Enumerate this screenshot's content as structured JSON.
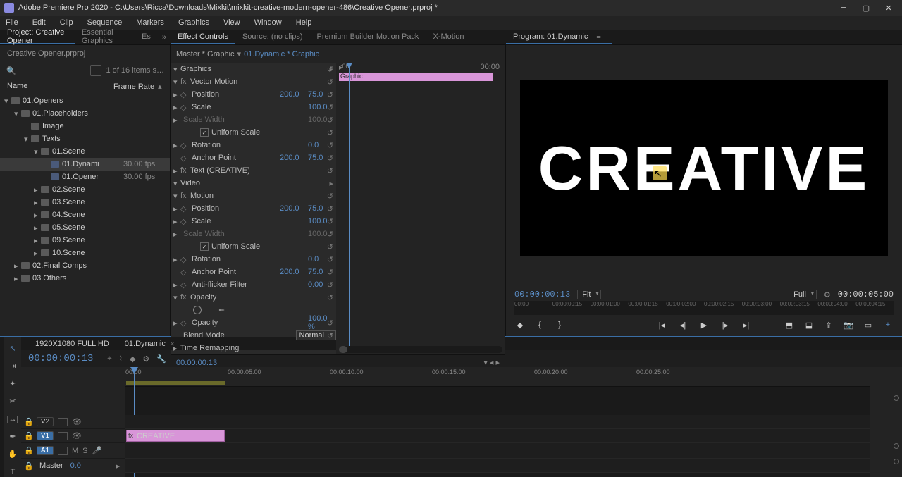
{
  "window": {
    "title": "Adobe Premiere Pro 2020 - C:\\Users\\Ricca\\Downloads\\Mixkit\\mixkit-creative-modern-opener-486\\Creative Opener.prproj *"
  },
  "menu": {
    "items": [
      "File",
      "Edit",
      "Clip",
      "Sequence",
      "Markers",
      "Graphics",
      "View",
      "Window",
      "Help"
    ]
  },
  "top_tabs_left": [
    {
      "label": "Project: Creative Opener",
      "active": true
    },
    {
      "label": "Essential Graphics",
      "active": false
    },
    {
      "label": "Es",
      "active": false
    }
  ],
  "top_tabs_mid": [
    {
      "label": "Effect Controls",
      "active": true
    },
    {
      "label": "Source: (no clips)",
      "active": false
    },
    {
      "label": "Premium Builder Motion Pack",
      "active": false
    },
    {
      "label": "X-Motion",
      "active": false
    }
  ],
  "program_header": "Program: 01.Dynamic",
  "project": {
    "subtitle": "Creative Opener.prproj",
    "items_info": "1 of 16 items s…",
    "col_name": "Name",
    "col_fr": "Frame Rate",
    "tree": [
      {
        "indent": 0,
        "toggle": "▾",
        "icon": "folder",
        "label": "01.Openers",
        "fr": ""
      },
      {
        "indent": 1,
        "toggle": "▾",
        "icon": "folder",
        "label": "01.Placeholders",
        "fr": ""
      },
      {
        "indent": 2,
        "toggle": "",
        "icon": "folder",
        "label": "Image",
        "fr": ""
      },
      {
        "indent": 2,
        "toggle": "▾",
        "icon": "folder",
        "label": "Texts",
        "fr": ""
      },
      {
        "indent": 3,
        "toggle": "▾",
        "icon": "folder",
        "label": "01.Scene",
        "fr": ""
      },
      {
        "indent": 4,
        "toggle": "",
        "icon": "seq",
        "label": "01.Dynami",
        "fr": "30.00 fps",
        "selected": true
      },
      {
        "indent": 4,
        "toggle": "",
        "icon": "seq",
        "label": "01.Opener",
        "fr": "30.00 fps"
      },
      {
        "indent": 3,
        "toggle": "▸",
        "icon": "folder",
        "label": "02.Scene",
        "fr": ""
      },
      {
        "indent": 3,
        "toggle": "▸",
        "icon": "folder",
        "label": "03.Scene",
        "fr": ""
      },
      {
        "indent": 3,
        "toggle": "▸",
        "icon": "folder",
        "label": "04.Scene",
        "fr": ""
      },
      {
        "indent": 3,
        "toggle": "▸",
        "icon": "folder",
        "label": "05.Scene",
        "fr": ""
      },
      {
        "indent": 3,
        "toggle": "▸",
        "icon": "folder",
        "label": "09.Scene",
        "fr": ""
      },
      {
        "indent": 3,
        "toggle": "▸",
        "icon": "folder",
        "label": "10.Scene",
        "fr": ""
      },
      {
        "indent": 1,
        "toggle": "▸",
        "icon": "folder",
        "label": "02.Final Comps",
        "fr": ""
      },
      {
        "indent": 1,
        "toggle": "▸",
        "icon": "folder",
        "label": "03.Others",
        "fr": ""
      }
    ]
  },
  "effect_controls": {
    "master": "Master * Graphic",
    "arrow": "▾",
    "instance": "01.Dynamic * Graphic",
    "clip_label": "Graphic",
    "time_right": "00:00",
    "ruler_left": ":00:",
    "rows": [
      {
        "type": "group",
        "toggle": "▾",
        "name": "Graphics",
        "reset": true,
        "play": true
      },
      {
        "type": "fx",
        "toggle": "▾",
        "fx": true,
        "name": "Vector Motion",
        "reset": true
      },
      {
        "type": "prop",
        "toggle": "▸",
        "key": true,
        "name": "Position",
        "v1": "200.0",
        "v2": "75.0",
        "reset": true
      },
      {
        "type": "prop",
        "toggle": "▸",
        "key": true,
        "name": "Scale",
        "v1": "100.0",
        "reset": true
      },
      {
        "type": "prop",
        "toggle": "▸",
        "dim": true,
        "name": "Scale Width",
        "v1": "100.0",
        "reset": true
      },
      {
        "type": "check",
        "checked": true,
        "name": "Uniform Scale",
        "reset": true
      },
      {
        "type": "prop",
        "toggle": "▸",
        "key": true,
        "name": "Rotation",
        "v1": "0.0",
        "reset": true
      },
      {
        "type": "prop",
        "key": true,
        "name": "Anchor Point",
        "v1": "200.0",
        "v2": "75.0",
        "reset": true
      },
      {
        "type": "fx",
        "toggle": "▸",
        "fx": true,
        "name": "Text (CREATIVE)",
        "reset": true
      },
      {
        "type": "group",
        "toggle": "▾",
        "name": "Video",
        "play": true
      },
      {
        "type": "fx",
        "toggle": "▾",
        "fx": true,
        "name": "Motion",
        "reset": true
      },
      {
        "type": "prop",
        "toggle": "▸",
        "key": true,
        "name": "Position",
        "v1": "200.0",
        "v2": "75.0",
        "reset": true
      },
      {
        "type": "prop",
        "toggle": "▸",
        "key": true,
        "name": "Scale",
        "v1": "100.0",
        "reset": true
      },
      {
        "type": "prop",
        "toggle": "▸",
        "dim": true,
        "name": "Scale Width",
        "v1": "100.0",
        "reset": true
      },
      {
        "type": "check",
        "checked": true,
        "name": "Uniform Scale",
        "reset": true
      },
      {
        "type": "prop",
        "toggle": "▸",
        "key": true,
        "name": "Rotation",
        "v1": "0.0",
        "reset": true
      },
      {
        "type": "prop",
        "key": true,
        "name": "Anchor Point",
        "v1": "200.0",
        "v2": "75.0",
        "reset": true
      },
      {
        "type": "prop",
        "toggle": "▸",
        "key": true,
        "name": "Anti-flicker Filter",
        "v1": "0.00",
        "reset": true
      },
      {
        "type": "fx",
        "toggle": "▾",
        "fx": true,
        "name": "Opacity",
        "reset": true
      },
      {
        "type": "masks"
      },
      {
        "type": "prop",
        "toggle": "▸",
        "key": true,
        "name": "Opacity",
        "v1": "100.0 %",
        "reset": true
      },
      {
        "type": "select",
        "name": "Blend Mode",
        "value": "Normal",
        "reset": true
      },
      {
        "type": "fx",
        "toggle": "▸",
        "name": "Time Remapping"
      }
    ],
    "bottom_tc": "00:00:00:13"
  },
  "program": {
    "text": "CREATIVE",
    "tc": "00:00:00:13",
    "fit": "Fit",
    "full": "Full",
    "duration": "00:00:05:00",
    "ruler": [
      "00:00",
      "00:00:00:15",
      "00:00:01:00",
      "00:00:01:15",
      "00:00:02:00",
      "00:00:02:15",
      "00:00:03:00",
      "00:00:03:15",
      "00:00:04:00",
      "00:00:04:15"
    ]
  },
  "timeline": {
    "tabs": [
      {
        "label": "1920X1080 FULL HD",
        "active": false
      },
      {
        "label": "01.Dynamic",
        "active": true
      }
    ],
    "tc": "00:00:00:13",
    "ruler": [
      "00:00",
      "00:00:05:00",
      "00:00:10:00",
      "00:00:15:00",
      "00:00:20:00",
      "00:00:25:00"
    ],
    "tracks_v": [
      {
        "label": "V2"
      },
      {
        "label": "V1",
        "selected": true
      }
    ],
    "tracks_a": [
      {
        "label": "A1",
        "selected": true
      }
    ],
    "master_label": "Master",
    "master_val": "0.0",
    "m": "M",
    "s": "S",
    "clip": {
      "label": "CREATIVE"
    }
  }
}
